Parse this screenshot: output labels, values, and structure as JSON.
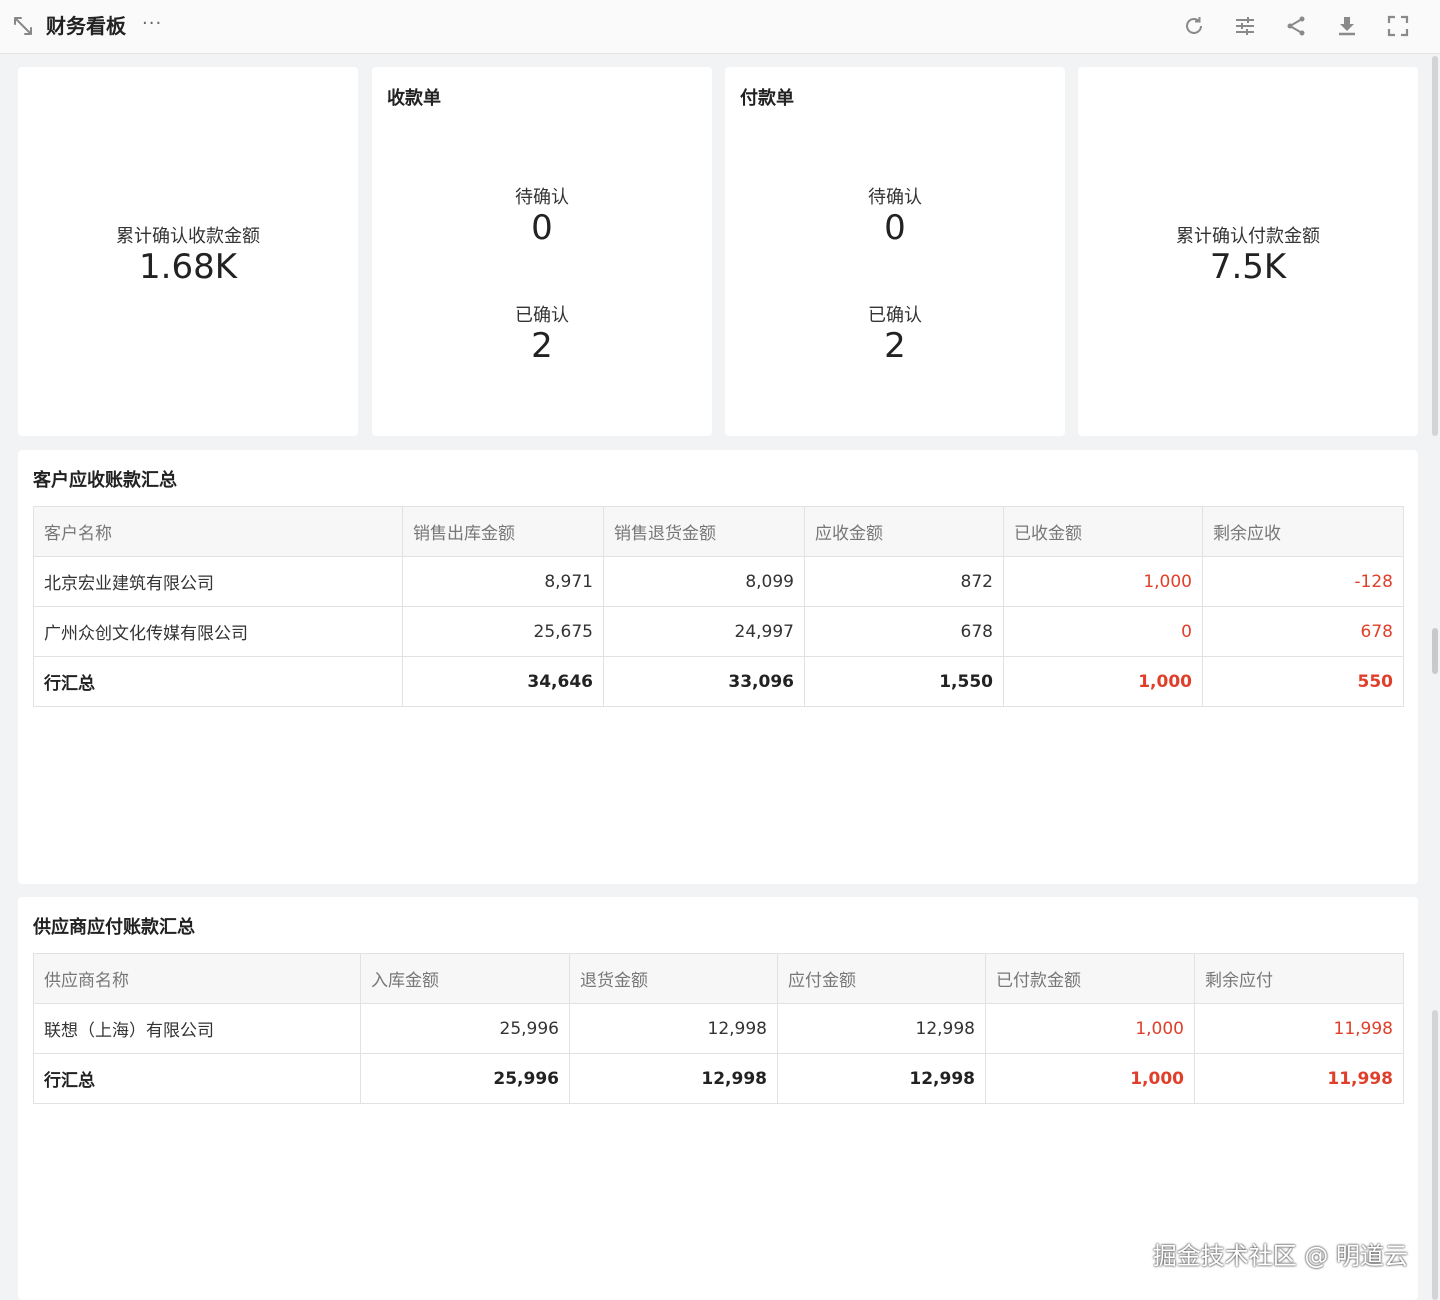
{
  "header": {
    "title": "财务看板",
    "more": "···",
    "icons": [
      "refresh-icon",
      "filter-sliders-icon",
      "share-icon",
      "download-icon",
      "fullscreen-icon"
    ]
  },
  "stats": {
    "total_received": {
      "label": "累计确认收款金额",
      "value": "1.68K"
    },
    "receipts": {
      "title": "收款单",
      "pending_label": "待确认",
      "pending_value": "0",
      "confirmed_label": "已确认",
      "confirmed_value": "2"
    },
    "payments": {
      "title": "付款单",
      "pending_label": "待确认",
      "pending_value": "0",
      "confirmed_label": "已确认",
      "confirmed_value": "2"
    },
    "total_paid": {
      "label": "累计确认付款金额",
      "value": "7.5K"
    }
  },
  "receivables": {
    "title": "客户应收账款汇总",
    "columns": [
      "客户名称",
      "销售出库金额",
      "销售退货金额",
      "应收金额",
      "已收金额",
      "剩余应收"
    ],
    "rows": [
      [
        "北京宏业建筑有限公司",
        "8,971",
        "8,099",
        "872",
        "1,000",
        "-128"
      ],
      [
        "广州众创文化传媒有限公司",
        "25,675",
        "24,997",
        "678",
        "0",
        "678"
      ]
    ],
    "total": [
      "行汇总",
      "34,646",
      "33,096",
      "1,550",
      "1,000",
      "550"
    ]
  },
  "payables": {
    "title": "供应商应付账款汇总",
    "columns": [
      "供应商名称",
      "入库金额",
      "退货金额",
      "应付金额",
      "已付款金额",
      "剩余应付"
    ],
    "rows": [
      [
        "联想（上海）有限公司",
        "25,996",
        "12,998",
        "12,998",
        "1,000",
        "11,998"
      ]
    ],
    "total": [
      "行汇总",
      "25,996",
      "12,998",
      "12,998",
      "1,000",
      "11,998"
    ]
  },
  "colors": {
    "accent_red": "#e0402b",
    "header_bg": "#f7f7f7",
    "page_bg": "#f2f3f5"
  },
  "watermark": "掘金技术社区 @ 明道云"
}
